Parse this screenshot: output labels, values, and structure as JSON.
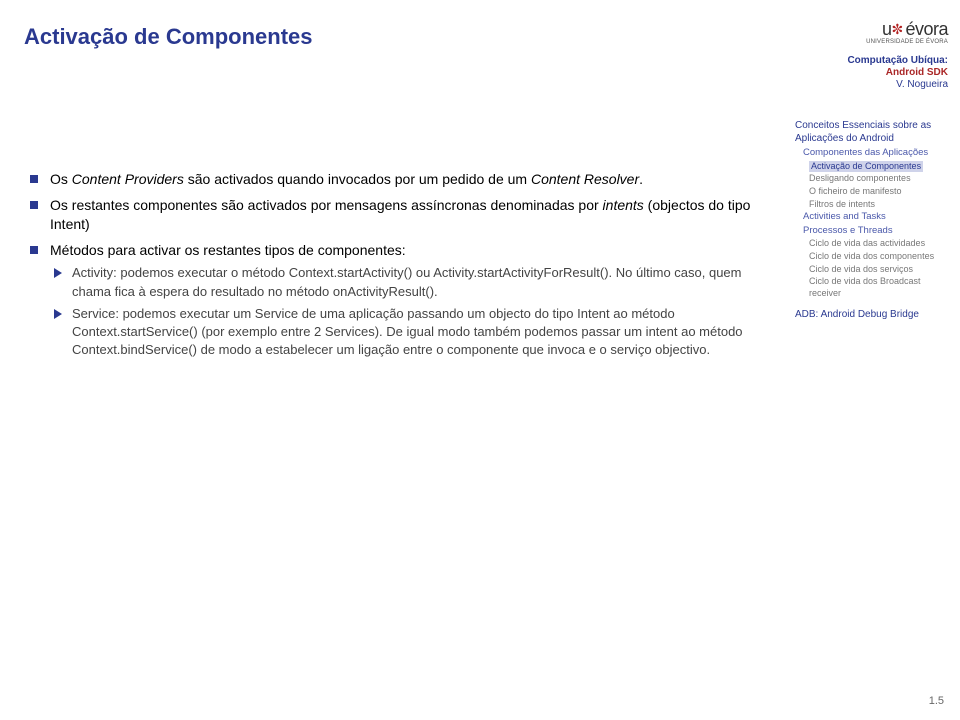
{
  "title": "Activação de Componentes",
  "logo": {
    "u": "u",
    "evora": "évora",
    "sub": "UNIVERSIDADE DE ÉVORA"
  },
  "course": {
    "line1": "Computação Ubíqua:",
    "line2": "Android SDK",
    "line3": "V. Nogueira"
  },
  "bullets": {
    "b1_a": "Os ",
    "b1_b": "Content Providers",
    "b1_c": " são activados quando invocados por um pedido de um ",
    "b1_d": "Content Resolver",
    "b1_e": ".",
    "b2_a": "Os restantes componentes são activados por",
    "b2_b": " mensagens assíncronas denominadas por ",
    "b2_c": "intents",
    "b2_d": " (objectos do tipo Intent)",
    "b3": "Métodos para activar os restantes tipos de componentes:",
    "s1": "Activity: podemos executar o método Context.startActivity() ou Activity.startActivityForResult(). No último caso, quem chama fica à espera do resultado no método onActivityResult().",
    "s2": "Service: podemos executar um Service de uma aplicação passando um objecto do tipo Intent ao método Context.startService() (por exemplo entre 2 Services). De igual modo também podemos passar um intent ao método Context.bindService() de modo a estabelecer um ligação entre o componente que invoca e o serviço objectivo."
  },
  "nav": {
    "l1a": "Conceitos Essenciais sobre as Aplicações do Android",
    "l2a": "Componentes das Aplicações",
    "l3a": "Activação de Componentes",
    "l3b": "Desligando componentes",
    "l3c": "O ficheiro de manifesto",
    "l3d": "Filtros de intents",
    "l2b": "Activities and Tasks",
    "l2c": "Processos e Threads",
    "l3e": "Ciclo de vida das actividades",
    "l3f": "Ciclo de vida dos componentes",
    "l3g": "Ciclo de vida dos serviços",
    "l3h": "Ciclo de vida dos Broadcast receiver",
    "l1b": "ADB: Android Debug Bridge"
  },
  "pagenum": "1.5"
}
